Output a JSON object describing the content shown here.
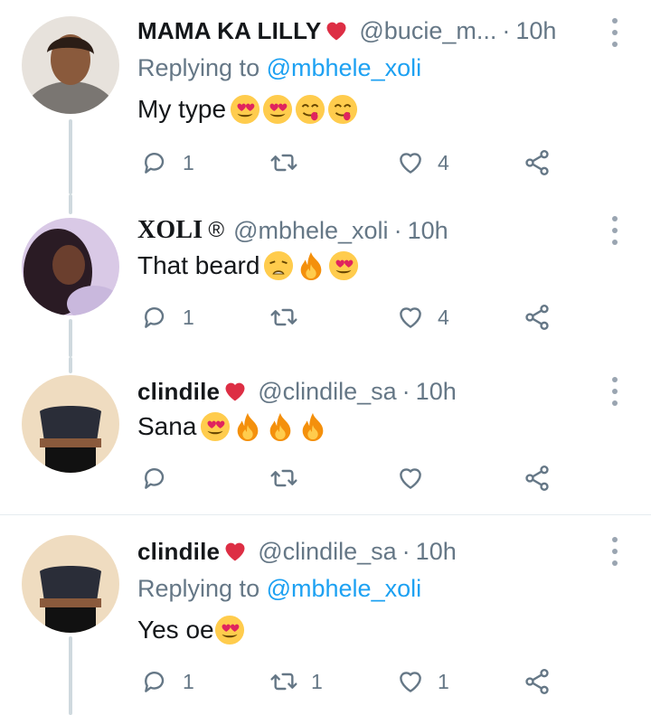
{
  "colors": {
    "link": "#1da1f2",
    "secondary": "#657786",
    "text": "#14171a",
    "thread": "#cfd9de"
  },
  "tweets": [
    {
      "name": "MAMA KA LILLY",
      "handle": "@bucie_m...",
      "time": "10h",
      "replying_label": "Replying to",
      "replying_to": "@mbhele_xoli",
      "text": "My type",
      "emojis": [
        "heart-eyes-emoji",
        "heart-eyes-emoji",
        "yum-emoji",
        "yum-emoji"
      ],
      "replies": "1",
      "retweets": "",
      "likes": "4"
    },
    {
      "name": "XOLI",
      "registered": "®",
      "handle": "@mbhele_xoli",
      "time": "10h",
      "text": "That beard",
      "emojis": [
        "weary-face-emoji",
        "fire-emoji",
        "heart-eyes-emoji"
      ],
      "replies": "1",
      "retweets": "",
      "likes": "4"
    },
    {
      "name": "clindile",
      "handle": "@clindile_sa",
      "time": "10h",
      "text": "Sana",
      "emojis": [
        "heart-eyes-emoji",
        "fire-emoji",
        "fire-emoji",
        "fire-emoji"
      ],
      "replies": "",
      "retweets": "",
      "likes": ""
    },
    {
      "name": "clindile",
      "handle": "@clindile_sa",
      "time": "10h",
      "replying_label": "Replying to",
      "replying_to": "@mbhele_xoli",
      "text": "Yes oe",
      "emojis": [
        "heart-eyes-emoji"
      ],
      "replies": "1",
      "retweets": "1",
      "likes": "1"
    }
  ],
  "separator_dot": "·"
}
